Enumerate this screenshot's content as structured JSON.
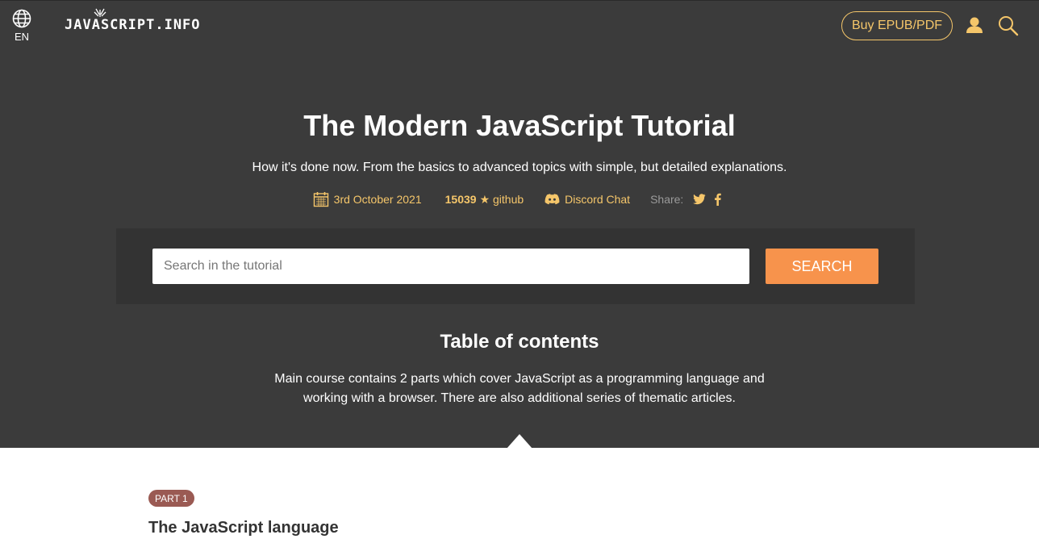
{
  "header": {
    "language": "EN",
    "logo": "JAVASCRIPT.INFO",
    "buy_button": "Buy EPUB/PDF",
    "icons": {
      "language": "globe-icon",
      "user": "user-icon",
      "search": "search-icon"
    }
  },
  "hero": {
    "title": "The Modern JavaScript Tutorial",
    "subtitle": "How it's done now. From the basics to advanced topics with simple, but detailed explanations.",
    "date": "3rd October 2021",
    "github_stars": "15039",
    "github_label": "★ github",
    "discord": "Discord Chat",
    "share_label": "Share:",
    "share_icons": [
      "twitter-icon",
      "facebook-icon"
    ]
  },
  "search": {
    "placeholder": "Search in the tutorial",
    "value": "",
    "button": "SEARCH"
  },
  "toc": {
    "title": "Table of contents",
    "description": "Main course contains 2 parts which cover JavaScript as a programming language and working with a browser. There are also additional series of thematic articles."
  },
  "part1": {
    "badge": "PART 1",
    "title": "The JavaScript language"
  },
  "colors": {
    "header_bg": "#3b3b3b",
    "accent_yellow": "#f5c66a",
    "search_button": "#f7934c",
    "part_badge": "#9a5a53"
  }
}
